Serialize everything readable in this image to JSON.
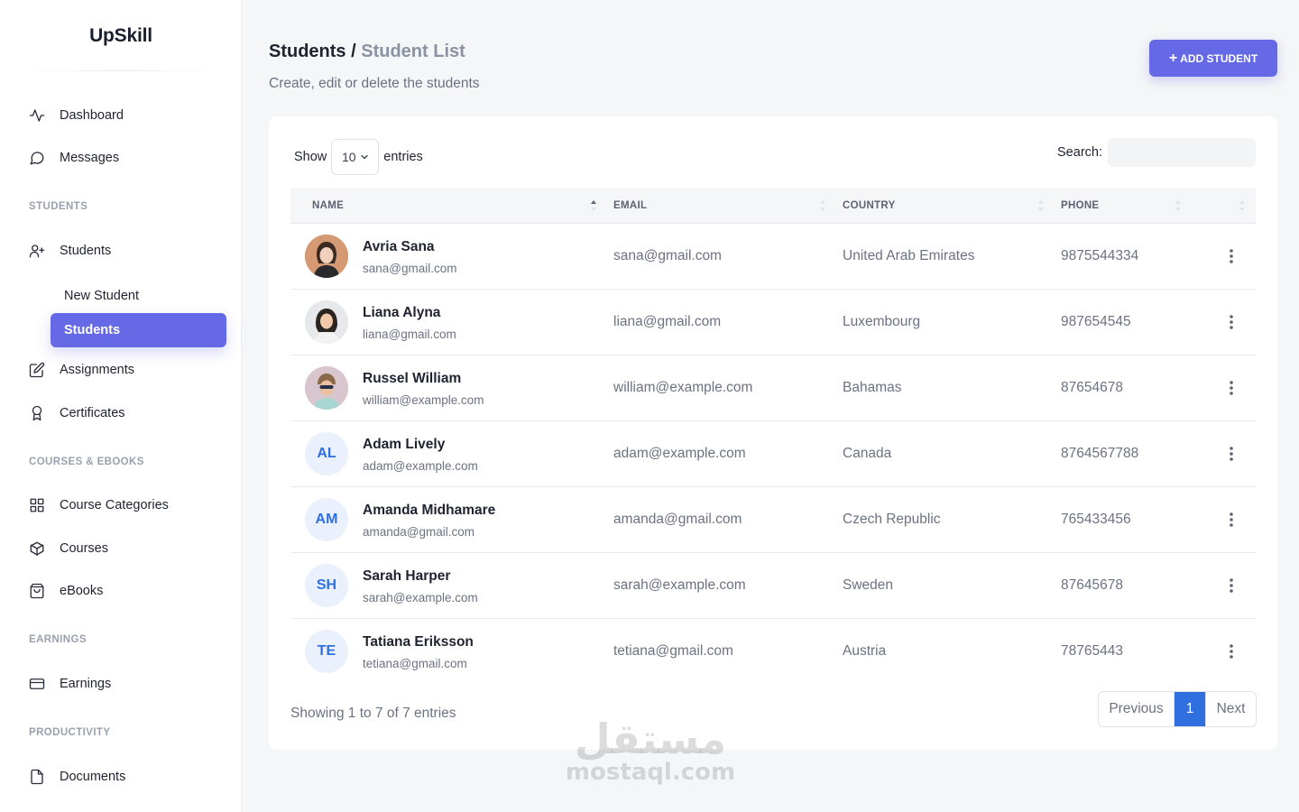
{
  "app": {
    "brand": "UpSkill"
  },
  "sidebar": {
    "items": [
      {
        "label": "Dashboard",
        "icon": "activity-icon"
      },
      {
        "label": "Messages",
        "icon": "message-icon"
      }
    ],
    "sections": {
      "students": "STUDENTS",
      "courses": "COURSES & EBOOKS",
      "earnings": "EARNINGS",
      "productivity": "PRODUCTIVITY"
    },
    "students_item": {
      "label": "Students",
      "icon": "user-plus-icon"
    },
    "students_sub": {
      "new_student": "New Student",
      "students": "Students"
    },
    "more": [
      {
        "label": "Assignments",
        "icon": "edit-icon"
      },
      {
        "label": "Certificates",
        "icon": "award-icon"
      }
    ],
    "courses": [
      {
        "label": "Course Categories",
        "icon": "grid-icon"
      },
      {
        "label": "Courses",
        "icon": "box-icon"
      },
      {
        "label": "eBooks",
        "icon": "bag-icon"
      }
    ],
    "earnings_item": {
      "label": "Earnings",
      "icon": "credit-card-icon"
    },
    "productivity_item": {
      "label": "Documents",
      "icon": "file-icon"
    }
  },
  "header": {
    "crumb_root": "Students",
    "crumb_sep": " / ",
    "crumb_current": "Student List",
    "subtitle": "Create, edit or delete the students",
    "add_button": "ADD STUDENT"
  },
  "table_controls": {
    "show_label": "Show",
    "entries_value": "10",
    "entries_label": "entries",
    "search_label": "Search:"
  },
  "columns": {
    "name": "NAME",
    "email": "EMAIL",
    "country": "COUNTRY",
    "phone": "PHONE"
  },
  "rows": [
    {
      "name": "Avria Sana",
      "email": "sana@gmail.com",
      "country": "United Arab Emirates",
      "phone": "9875544334",
      "initials": ""
    },
    {
      "name": "Liana Alyna",
      "email": "liana@gmail.com",
      "country": "Luxembourg",
      "phone": "987654545",
      "initials": ""
    },
    {
      "name": "Russel William",
      "email": "william@example.com",
      "country": "Bahamas",
      "phone": "87654678",
      "initials": ""
    },
    {
      "name": "Adam Lively",
      "email": "adam@example.com",
      "country": "Canada",
      "phone": "8764567788",
      "initials": "AL"
    },
    {
      "name": "Amanda Midhamare",
      "email": "amanda@gmail.com",
      "country": "Czech Republic",
      "phone": "765433456",
      "initials": "AM"
    },
    {
      "name": "Sarah Harper",
      "email": "sarah@example.com",
      "country": "Sweden",
      "phone": "87645678",
      "initials": "SH"
    },
    {
      "name": "Tatiana Eriksson",
      "email": "tetiana@gmail.com",
      "country": "Austria",
      "phone": "78765443",
      "initials": "TE"
    }
  ],
  "footer": {
    "showing": "Showing 1 to 7 of 7 entries",
    "prev": "Previous",
    "page": "1",
    "next": "Next"
  },
  "watermark": {
    "arabic": "مستقل",
    "latin": "mostaql.com"
  },
  "colors": {
    "accent": "#6669e6",
    "pager_active": "#2f6fe0",
    "initials_bg": "#eaf1fc",
    "initials_text": "#2f6fe0"
  }
}
